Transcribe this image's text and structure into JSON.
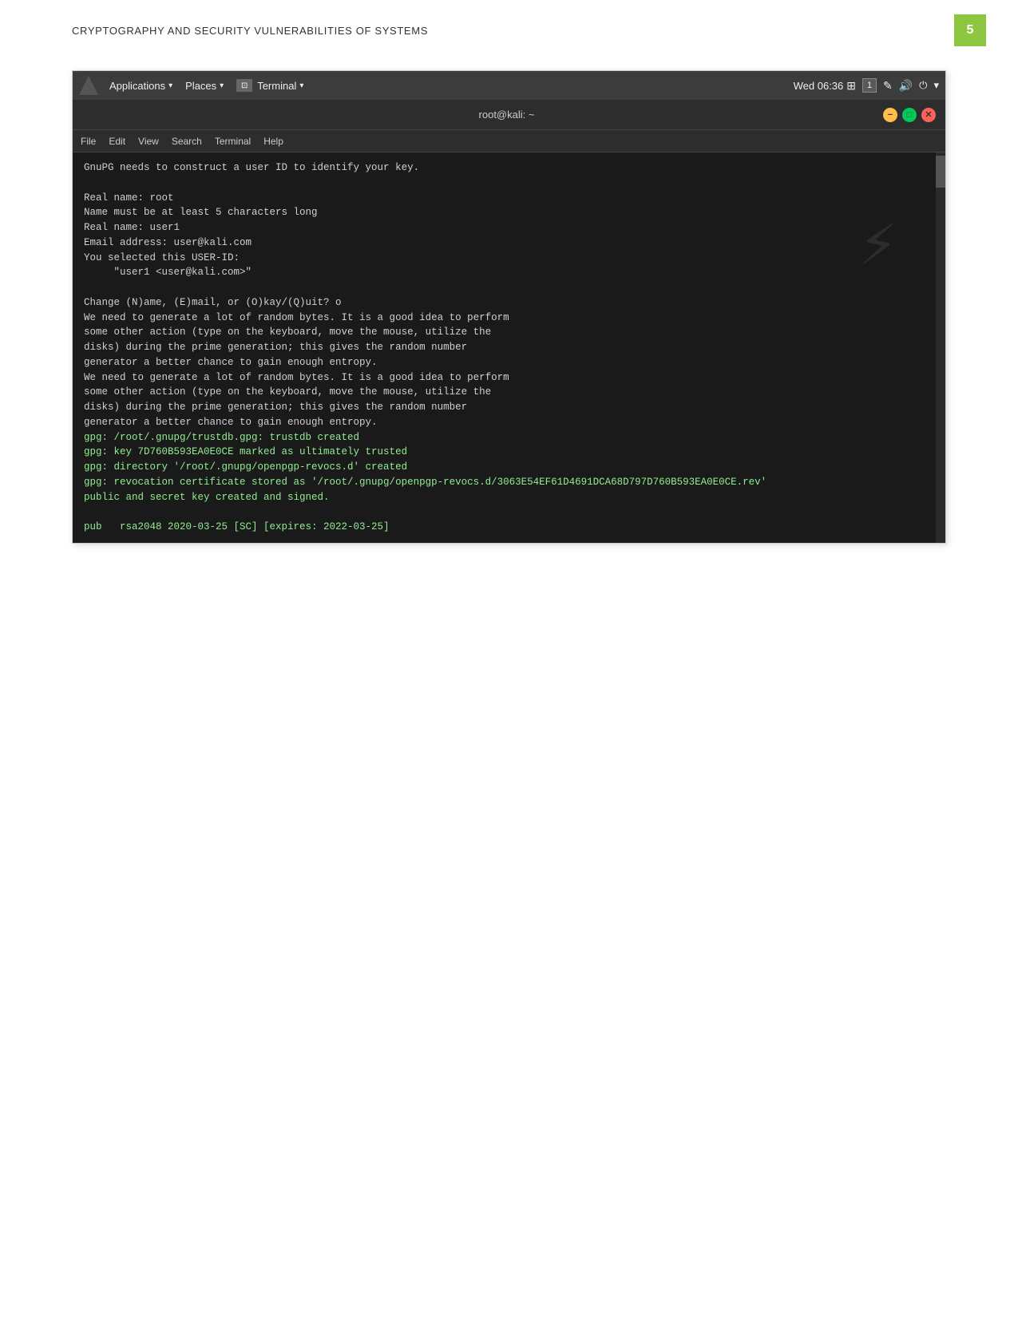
{
  "page": {
    "title": "CRYPTOGRAPHY AND SECURITY VULNERABILITIES OF SYSTEMS",
    "page_number": "5"
  },
  "taskbar": {
    "applications_label": "Applications",
    "places_label": "Places",
    "terminal_label": "Terminal",
    "clock": "Wed 06:36",
    "num_badge": "1"
  },
  "terminal": {
    "title": "root@kali: ~",
    "menu_items": [
      "File",
      "Edit",
      "View",
      "Search",
      "Terminal",
      "Help"
    ],
    "controls": {
      "minimize": "−",
      "maximize": "□",
      "close": "✕"
    },
    "content_lines": [
      "GnuPG needs to construct a user ID to identify your key.",
      "",
      "Real name: root",
      "Name must be at least 5 characters long",
      "Real name: user1",
      "Email address: user@kali.com",
      "You selected this USER-ID:",
      "     \"user1 <user@kali.com>\"",
      "",
      "Change (N)ame, (E)mail, or (O)kay/(Q)uit? o",
      "We need to generate a lot of random bytes. It is a good idea to perform",
      "some other action (type on the keyboard, move the mouse, utilize the",
      "disks) during the prime generation; this gives the random number",
      "generator a better chance to gain enough entropy.",
      "We need to generate a lot of random bytes. It is a good idea to perform",
      "some other action (type on the keyboard, move the mouse, utilize the",
      "disks) during the prime generation; this gives the random number",
      "generator a better chance to gain enough entropy.",
      "gpg: /root/.gnupg/trustdb.gpg: trustdb created",
      "gpg: key 7D760B593EA0E0CE marked as ultimately trusted",
      "gpg: directory '/root/.gnupg/openpgp-revocs.d' created",
      "gpg: revocation certificate stored as '/root/.gnupg/openpgp-revocs.d/3063E54EF61D4691DCA68D797D760B593EA0E0CE.rev'",
      "public and secret key created and signed.",
      "",
      "pub   rsa2048 2020-03-25 [SC] [expires: 2022-03-25]"
    ]
  }
}
